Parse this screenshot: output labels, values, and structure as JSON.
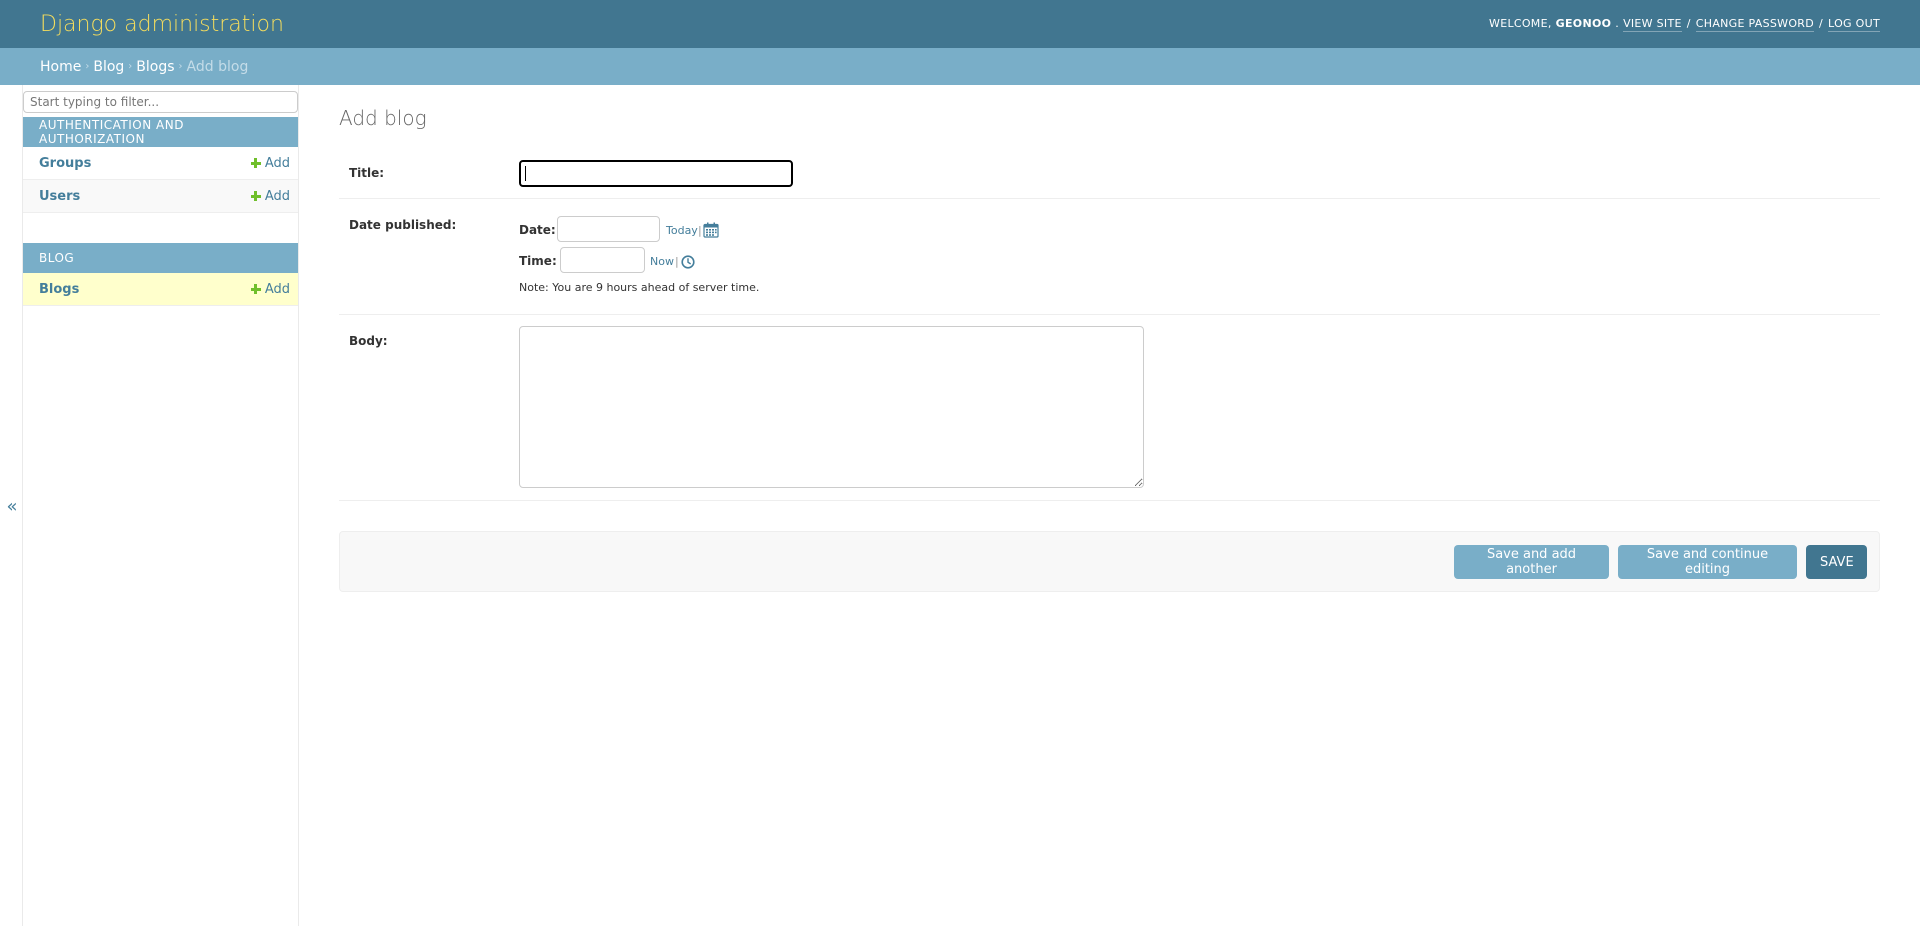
{
  "header": {
    "branding": "Django administration",
    "welcome_prefix": "WELCOME,",
    "username": "GEONOO",
    "view_site": "VIEW SITE",
    "change_password": "CHANGE PASSWORD",
    "log_out": "LOG OUT",
    "separator": "/"
  },
  "breadcrumbs": {
    "items": [
      "Home",
      "Blog",
      "Blogs"
    ],
    "current": "Add blog",
    "separator": "›"
  },
  "sidebar": {
    "filter_placeholder": "Start typing to filter...",
    "modules": [
      {
        "title": "AUTHENTICATION AND AUTHORIZATION",
        "models": [
          {
            "name": "Groups",
            "add_label": "Add"
          },
          {
            "name": "Users",
            "add_label": "Add"
          }
        ]
      },
      {
        "title": "BLOG",
        "models": [
          {
            "name": "Blogs",
            "add_label": "Add",
            "current": true
          }
        ]
      }
    ],
    "toggle_glyph": "«"
  },
  "content": {
    "page_title": "Add blog",
    "fields": {
      "title": {
        "label": "Title:",
        "value": ""
      },
      "date_published": {
        "label": "Date published:",
        "date_label": "Date:",
        "date_value": "",
        "today_link": "Today",
        "time_label": "Time:",
        "time_value": "",
        "now_link": "Now",
        "pipe": "|",
        "note": "Note: You are 9 hours ahead of server time."
      },
      "body": {
        "label": "Body:",
        "value": ""
      }
    },
    "buttons": {
      "save_add_another": "Save and add another",
      "save_continue": "Save and continue editing",
      "save": "SAVE"
    }
  },
  "colors": {
    "header_bg": "#417690",
    "branding": "#f5dd5d",
    "breadcrumbs_bg": "#79aec8",
    "link": "#447e9b",
    "add_icon": "#70bf2b",
    "current_row": "#ffffcc"
  },
  "icons": {
    "add": "plus-icon",
    "calendar": "calendar-icon",
    "clock": "clock-icon",
    "collapse": "collapse-sidebar-icon"
  }
}
